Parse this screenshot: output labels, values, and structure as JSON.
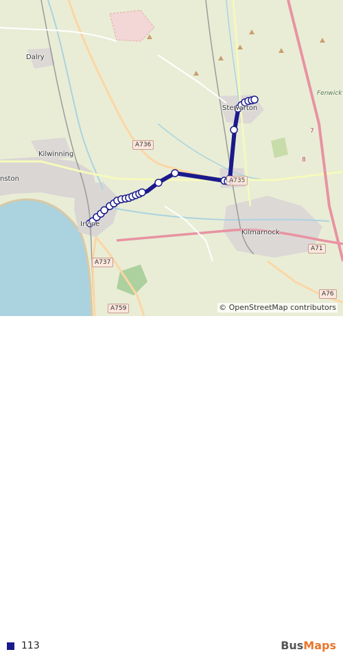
{
  "map": {
    "places": {
      "dalry": "Dalry",
      "kilwinning": "Kilwinning",
      "stevenston": "nston",
      "stewarton": "Stewarton",
      "fenwick_moor": "Fenwick Moor",
      "irvine": "Irvine",
      "kilmarnock": "Kilmarnock"
    },
    "roads": {
      "a736": "A736",
      "a737": "A737",
      "a759": "A759",
      "a71": "A71",
      "a76": "A76",
      "a735": "A735",
      "junction_7": "7",
      "junction_8": "8"
    },
    "route": {
      "color": "#1a1a8c",
      "stop_fill": "#ffffff"
    }
  },
  "attribution": {
    "symbol": "©",
    "text": "OpenStreetMap contributors"
  },
  "legend": {
    "route_color": "#1a1a8c",
    "route_label": "113"
  },
  "brand": {
    "part1": "Bus",
    "part2": "Maps"
  }
}
